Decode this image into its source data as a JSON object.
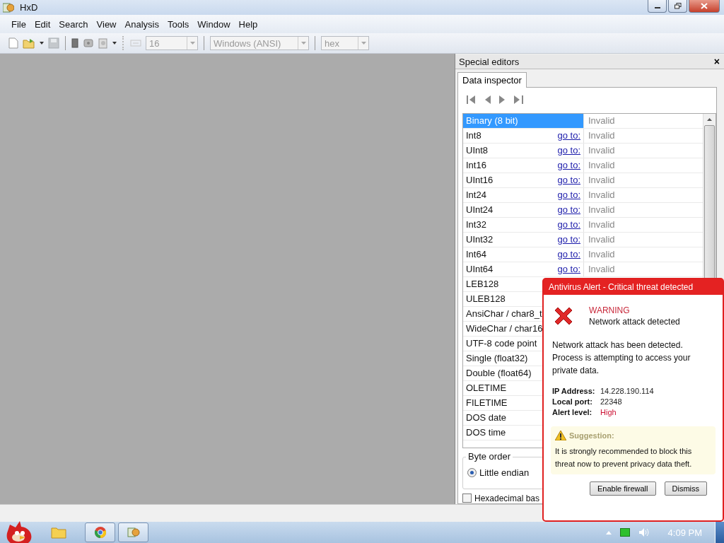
{
  "window": {
    "title": "HxD"
  },
  "menu": [
    {
      "label": "File"
    },
    {
      "label": "Edit"
    },
    {
      "label": "Search"
    },
    {
      "label": "View"
    },
    {
      "label": "Analysis"
    },
    {
      "label": "Tools"
    },
    {
      "label": "Window"
    },
    {
      "label": "Help"
    }
  ],
  "toolbar": {
    "bytes_per_row": "16",
    "charset": "Windows (ANSI)",
    "base": "hex",
    "disabled": true
  },
  "panel": {
    "title": "Special editors",
    "close": "×",
    "tabs": [
      {
        "label": "Data inspector",
        "selected": true
      }
    ],
    "rows": [
      {
        "name": "Binary (8 bit)",
        "value": "Invalid",
        "selected": true
      },
      {
        "name": "Int8",
        "goto": "go to:",
        "value": "Invalid",
        "selected": false
      },
      {
        "name": "UInt8",
        "goto": "go to:",
        "value": "Invalid",
        "selected": false
      },
      {
        "name": "Int16",
        "goto": "go to:",
        "value": "Invalid",
        "selected": false
      },
      {
        "name": "UInt16",
        "goto": "go to:",
        "value": "Invalid",
        "selected": false
      },
      {
        "name": "Int24",
        "goto": "go to:",
        "value": "Invalid",
        "selected": false
      },
      {
        "name": "UInt24",
        "goto": "go to:",
        "value": "Invalid",
        "selected": false
      },
      {
        "name": "Int32",
        "goto": "go to:",
        "value": "Invalid",
        "selected": false
      },
      {
        "name": "UInt32",
        "goto": "go to:",
        "value": "Invalid",
        "selected": false
      },
      {
        "name": "Int64",
        "goto": "go to:",
        "value": "Invalid",
        "selected": false
      },
      {
        "name": "UInt64",
        "goto": "go to:",
        "value": "Invalid",
        "selected": false
      },
      {
        "name": "LEB128",
        "selected": false
      },
      {
        "name": "ULEB128",
        "selected": false
      },
      {
        "name": "AnsiChar / char8_t",
        "selected": false
      },
      {
        "name": "WideChar / char16",
        "selected": false
      },
      {
        "name": "UTF-8 code point",
        "selected": false
      },
      {
        "name": "Single (float32)",
        "selected": false
      },
      {
        "name": "Double (float64)",
        "selected": false
      },
      {
        "name": "OLETIME",
        "selected": false
      },
      {
        "name": "FILETIME",
        "selected": false
      },
      {
        "name": "DOS date",
        "selected": false
      },
      {
        "name": "DOS time",
        "selected": false
      }
    ],
    "byte_order": {
      "title": "Byte order",
      "options": [
        {
          "label": "Little endian",
          "selected": true
        }
      ]
    },
    "hex_base": {
      "label": "Hexadecimal bas",
      "checked": false
    }
  },
  "alert": {
    "title": "Antivirus Alert - Critical threat detected",
    "heading": "WARNING",
    "subheading": "Network attack detected",
    "message": "Network attack has been detected. Process is attempting to access your private data.",
    "details": [
      {
        "label": "IP Address:",
        "value": "14.228.190.114",
        "color": "#222222"
      },
      {
        "label": "Local port:",
        "value": "22348",
        "color": "#222222"
      },
      {
        "label": "Alert level:",
        "value": "High",
        "color": "#cc1133"
      }
    ],
    "suggestion": {
      "title": "Suggestion:",
      "text": "It is strongly recommended to block this threat now to prevent privacy data theft."
    },
    "buttons": [
      "Enable firewall",
      "Dismiss"
    ]
  },
  "taskbar": {
    "time": "4:09 PM"
  }
}
